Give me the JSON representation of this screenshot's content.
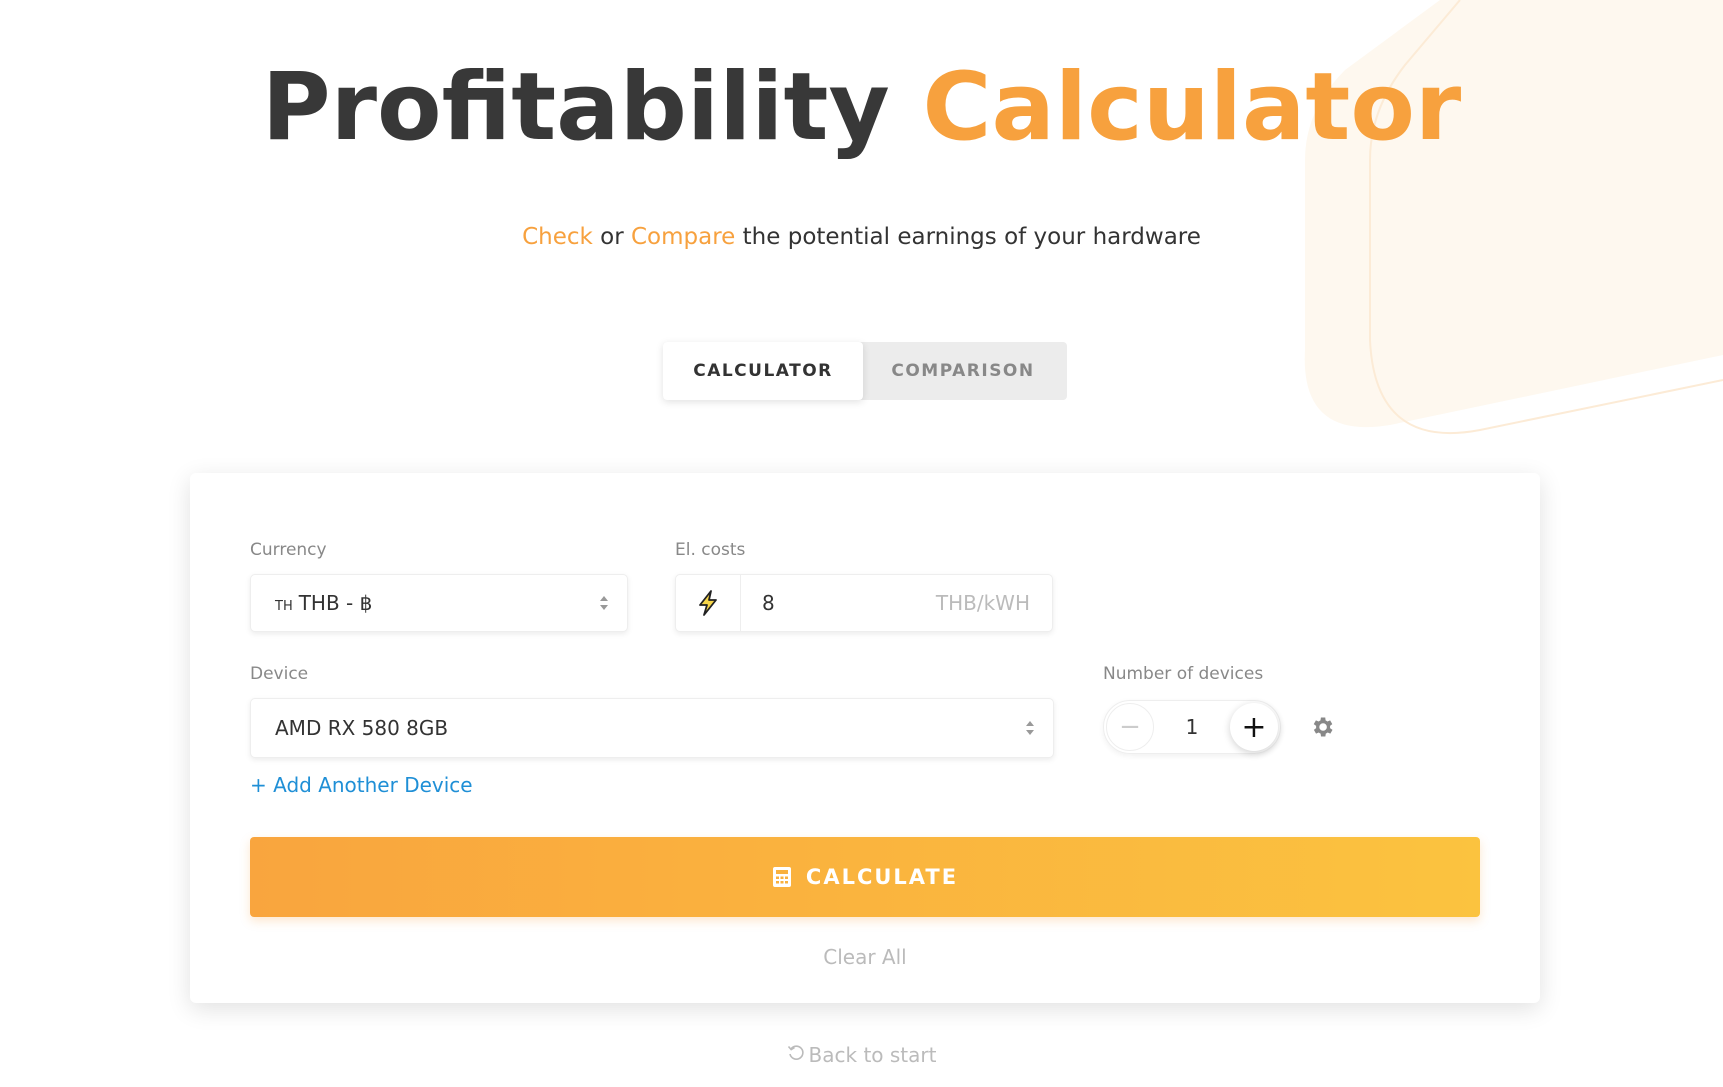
{
  "header": {
    "title_main": "Profitability",
    "title_accent": "Calculator",
    "subtitle_check": "Check",
    "subtitle_or": "or",
    "subtitle_compare": "Compare",
    "subtitle_rest": "the potential earnings of your hardware"
  },
  "tabs": [
    {
      "label": "CALCULATOR",
      "active": true
    },
    {
      "label": "COMPARISON",
      "active": false
    }
  ],
  "form": {
    "currency_label": "Currency",
    "currency_flag": "TH",
    "currency_value": "THB - ฿",
    "el_costs_label": "El. costs",
    "el_costs_value": "8",
    "el_costs_unit": "THB/kWH",
    "device_label": "Device",
    "device_value": "AMD RX 580 8GB",
    "num_devices_label": "Number of devices",
    "num_devices_value": "1",
    "minus_symbol": "−",
    "plus_symbol": "+",
    "add_device": "+ Add Another Device",
    "calculate": "CALCULATE",
    "clear_all": "Clear All"
  },
  "footer": {
    "back_to_start": "Back to start"
  },
  "colors": {
    "accent": "#f7a13e",
    "link": "#1f8fd6",
    "button_gradient_start": "#f9a53e",
    "button_gradient_end": "#fbc33f"
  },
  "icons": [
    "updown-arrows-icon",
    "bolt-icon",
    "gear-icon",
    "calculator-icon",
    "undo-icon"
  ]
}
